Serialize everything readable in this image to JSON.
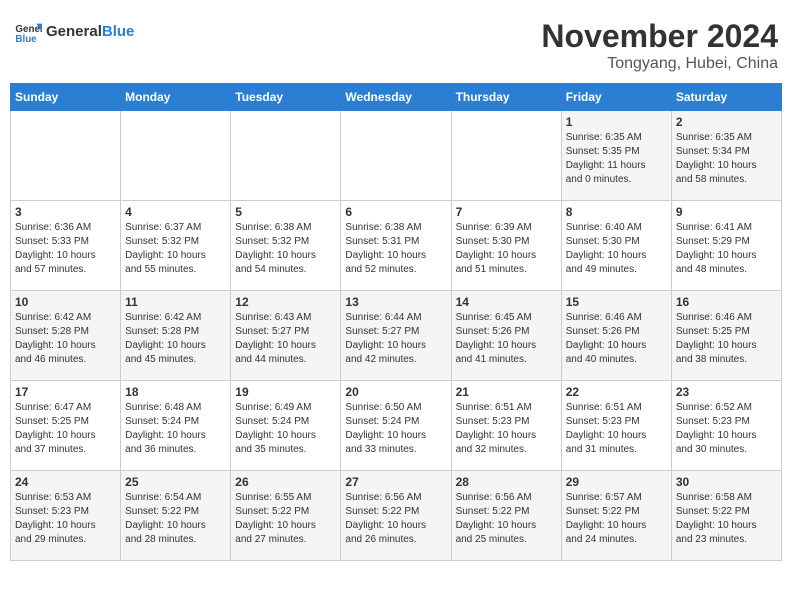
{
  "header": {
    "logo_line1": "General",
    "logo_line2": "Blue",
    "title": "November 2024",
    "subtitle": "Tongyang, Hubei, China"
  },
  "days_of_week": [
    "Sunday",
    "Monday",
    "Tuesday",
    "Wednesday",
    "Thursday",
    "Friday",
    "Saturday"
  ],
  "weeks": [
    [
      {
        "day": "",
        "info": ""
      },
      {
        "day": "",
        "info": ""
      },
      {
        "day": "",
        "info": ""
      },
      {
        "day": "",
        "info": ""
      },
      {
        "day": "",
        "info": ""
      },
      {
        "day": "1",
        "info": "Sunrise: 6:35 AM\nSunset: 5:35 PM\nDaylight: 11 hours\nand 0 minutes."
      },
      {
        "day": "2",
        "info": "Sunrise: 6:35 AM\nSunset: 5:34 PM\nDaylight: 10 hours\nand 58 minutes."
      }
    ],
    [
      {
        "day": "3",
        "info": "Sunrise: 6:36 AM\nSunset: 5:33 PM\nDaylight: 10 hours\nand 57 minutes."
      },
      {
        "day": "4",
        "info": "Sunrise: 6:37 AM\nSunset: 5:32 PM\nDaylight: 10 hours\nand 55 minutes."
      },
      {
        "day": "5",
        "info": "Sunrise: 6:38 AM\nSunset: 5:32 PM\nDaylight: 10 hours\nand 54 minutes."
      },
      {
        "day": "6",
        "info": "Sunrise: 6:38 AM\nSunset: 5:31 PM\nDaylight: 10 hours\nand 52 minutes."
      },
      {
        "day": "7",
        "info": "Sunrise: 6:39 AM\nSunset: 5:30 PM\nDaylight: 10 hours\nand 51 minutes."
      },
      {
        "day": "8",
        "info": "Sunrise: 6:40 AM\nSunset: 5:30 PM\nDaylight: 10 hours\nand 49 minutes."
      },
      {
        "day": "9",
        "info": "Sunrise: 6:41 AM\nSunset: 5:29 PM\nDaylight: 10 hours\nand 48 minutes."
      }
    ],
    [
      {
        "day": "10",
        "info": "Sunrise: 6:42 AM\nSunset: 5:28 PM\nDaylight: 10 hours\nand 46 minutes."
      },
      {
        "day": "11",
        "info": "Sunrise: 6:42 AM\nSunset: 5:28 PM\nDaylight: 10 hours\nand 45 minutes."
      },
      {
        "day": "12",
        "info": "Sunrise: 6:43 AM\nSunset: 5:27 PM\nDaylight: 10 hours\nand 44 minutes."
      },
      {
        "day": "13",
        "info": "Sunrise: 6:44 AM\nSunset: 5:27 PM\nDaylight: 10 hours\nand 42 minutes."
      },
      {
        "day": "14",
        "info": "Sunrise: 6:45 AM\nSunset: 5:26 PM\nDaylight: 10 hours\nand 41 minutes."
      },
      {
        "day": "15",
        "info": "Sunrise: 6:46 AM\nSunset: 5:26 PM\nDaylight: 10 hours\nand 40 minutes."
      },
      {
        "day": "16",
        "info": "Sunrise: 6:46 AM\nSunset: 5:25 PM\nDaylight: 10 hours\nand 38 minutes."
      }
    ],
    [
      {
        "day": "17",
        "info": "Sunrise: 6:47 AM\nSunset: 5:25 PM\nDaylight: 10 hours\nand 37 minutes."
      },
      {
        "day": "18",
        "info": "Sunrise: 6:48 AM\nSunset: 5:24 PM\nDaylight: 10 hours\nand 36 minutes."
      },
      {
        "day": "19",
        "info": "Sunrise: 6:49 AM\nSunset: 5:24 PM\nDaylight: 10 hours\nand 35 minutes."
      },
      {
        "day": "20",
        "info": "Sunrise: 6:50 AM\nSunset: 5:24 PM\nDaylight: 10 hours\nand 33 minutes."
      },
      {
        "day": "21",
        "info": "Sunrise: 6:51 AM\nSunset: 5:23 PM\nDaylight: 10 hours\nand 32 minutes."
      },
      {
        "day": "22",
        "info": "Sunrise: 6:51 AM\nSunset: 5:23 PM\nDaylight: 10 hours\nand 31 minutes."
      },
      {
        "day": "23",
        "info": "Sunrise: 6:52 AM\nSunset: 5:23 PM\nDaylight: 10 hours\nand 30 minutes."
      }
    ],
    [
      {
        "day": "24",
        "info": "Sunrise: 6:53 AM\nSunset: 5:23 PM\nDaylight: 10 hours\nand 29 minutes."
      },
      {
        "day": "25",
        "info": "Sunrise: 6:54 AM\nSunset: 5:22 PM\nDaylight: 10 hours\nand 28 minutes."
      },
      {
        "day": "26",
        "info": "Sunrise: 6:55 AM\nSunset: 5:22 PM\nDaylight: 10 hours\nand 27 minutes."
      },
      {
        "day": "27",
        "info": "Sunrise: 6:56 AM\nSunset: 5:22 PM\nDaylight: 10 hours\nand 26 minutes."
      },
      {
        "day": "28",
        "info": "Sunrise: 6:56 AM\nSunset: 5:22 PM\nDaylight: 10 hours\nand 25 minutes."
      },
      {
        "day": "29",
        "info": "Sunrise: 6:57 AM\nSunset: 5:22 PM\nDaylight: 10 hours\nand 24 minutes."
      },
      {
        "day": "30",
        "info": "Sunrise: 6:58 AM\nSunset: 5:22 PM\nDaylight: 10 hours\nand 23 minutes."
      }
    ]
  ]
}
